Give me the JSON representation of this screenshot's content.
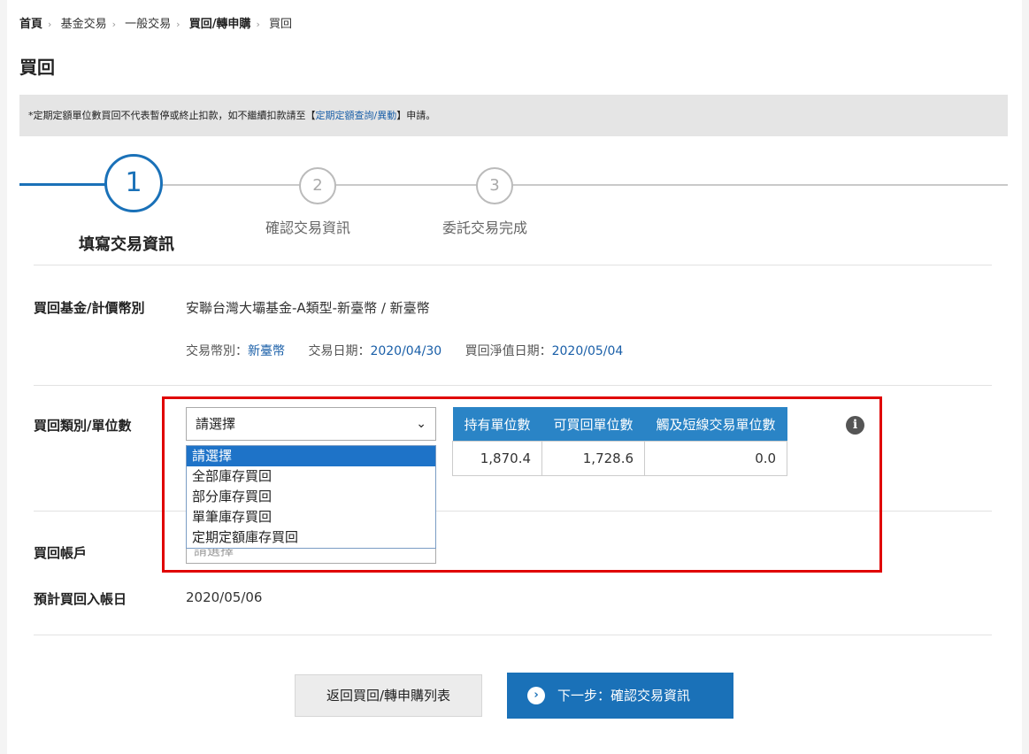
{
  "breadcrumb": [
    {
      "label": "首頁"
    },
    {
      "label": "基金交易"
    },
    {
      "label": "一般交易"
    },
    {
      "label": "買回/轉申購"
    },
    {
      "label": "買回"
    }
  ],
  "page_title": "買回",
  "notice": {
    "prefix": "*定期定額單位數買回不代表暫停或終止扣款，如不繼續扣款請至【",
    "link": "定期定額查詢/異動",
    "suffix": "】申請。"
  },
  "steps": [
    {
      "number": "1",
      "label": "填寫交易資訊"
    },
    {
      "number": "2",
      "label": "確認交易資訊"
    },
    {
      "number": "3",
      "label": "委託交易完成"
    }
  ],
  "fund": {
    "label": "買回基金/計價幣別",
    "value": "安聯台灣大壩基金-A類型-新臺幣 / 新臺幣",
    "currency_label": "交易幣別：",
    "currency_value": "新臺幣",
    "trade_date_label": "交易日期：",
    "trade_date_value": "2020/04/30",
    "nav_date_label": "買回淨值日期：",
    "nav_date_value": "2020/05/04"
  },
  "redemption": {
    "label": "買回類別/單位數",
    "select_value": "請選擇",
    "options": [
      "請選擇",
      "全部庫存買回",
      "部分庫存買回",
      "單筆庫存買回",
      "定期定額庫存買回"
    ],
    "hidden_select_value": "請選擇"
  },
  "units_table": {
    "headers": [
      "持有單位數",
      "可買回單位數",
      "觸及短線交易單位數"
    ],
    "values": [
      "1,870.4",
      "1,728.6",
      "0.0"
    ]
  },
  "account": {
    "label": "買回帳戶"
  },
  "expected_date": {
    "label": "預計買回入帳日",
    "value": "2020/05/06"
  },
  "buttons": {
    "back": "返回買回/轉申購列表",
    "next": "下一步：確認交易資訊"
  },
  "colors": {
    "accent": "#1a71b8",
    "highlight_border": "#e00000",
    "table_header": "#2a84c6"
  }
}
